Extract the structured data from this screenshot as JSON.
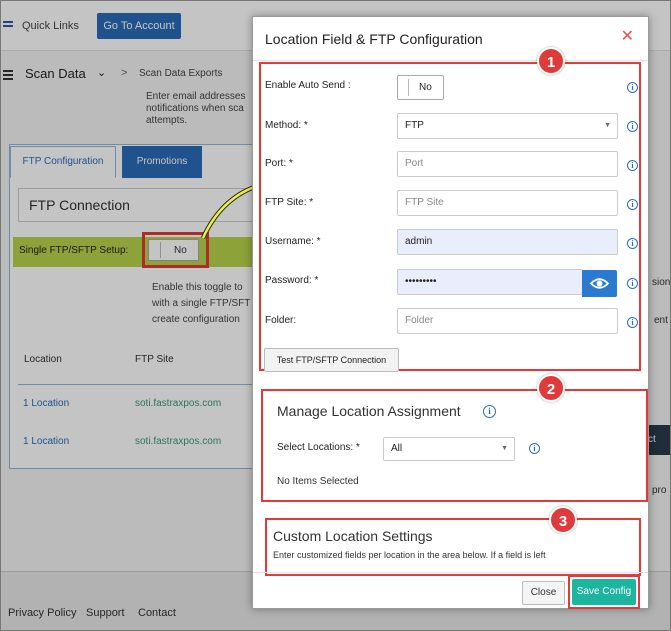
{
  "background": {
    "quick_links": "Quick Links",
    "go_to_account": "Go To Account",
    "nav_title": "Scan Data",
    "nav_caret": "⌄",
    "nav_sep": ">",
    "breadcrumb": "Scan Data Exports",
    "notification_text": "Enter email addresses notifications when sca attempts.",
    "tabs": [
      "FTP Configuration",
      "Promotions"
    ],
    "ftp_connection": "FTP Connection",
    "single_ftp_label": "Single FTP/SFTP Setup:",
    "single_ftp_toggle": "No",
    "help_text": "Enable this toggle to with a single FTP/SFT create configuration",
    "col_location": "Location",
    "col_ftp_site": "FTP Site",
    "rows": [
      {
        "location": "1 Location",
        "ftp_site": "soti.fastraxpos.com"
      },
      {
        "location": "1 Location",
        "ftp_site": "soti.fastraxpos.com"
      }
    ],
    "right_fragments": [
      "sion",
      "ent",
      "ct",
      "pro"
    ],
    "footer_links": [
      "Privacy Policy",
      "Support",
      "Contact"
    ]
  },
  "modal": {
    "title": "Location Field & FTP Configuration",
    "close": "✕",
    "badges": [
      "1",
      "2",
      "3"
    ],
    "fields": {
      "auto_send_label": "Enable Auto Send :",
      "auto_send_value": "No",
      "method_label": "Method: *",
      "method_value": "FTP",
      "port_label": "Port: *",
      "port_placeholder": "Port",
      "ftp_site_label": "FTP Site: *",
      "ftp_site_placeholder": "FTP Site",
      "username_label": "Username: *",
      "username_value": "admin",
      "password_label": "Password: *",
      "password_value": "•••••••••",
      "folder_label": "Folder:",
      "folder_placeholder": "Folder"
    },
    "info_icon": "i",
    "select_caret": "▼",
    "test_button": "Test FTP/SFTP Connection",
    "manage_title": "Manage Location Assignment",
    "select_locations_label": "Select Locations: *",
    "select_locations_value": "All",
    "no_items": "No Items Selected",
    "custom_title": "Custom Location Settings",
    "custom_desc": "Enter customized fields per location in the area below. If a field is left",
    "close_button": "Close",
    "save_button": "Save Config"
  },
  "colors": {
    "accent": "#2a6db8",
    "highlight_red": "#e03a3a",
    "highlight_green": "#b8d34a",
    "save_teal": "#1bb5a0"
  }
}
